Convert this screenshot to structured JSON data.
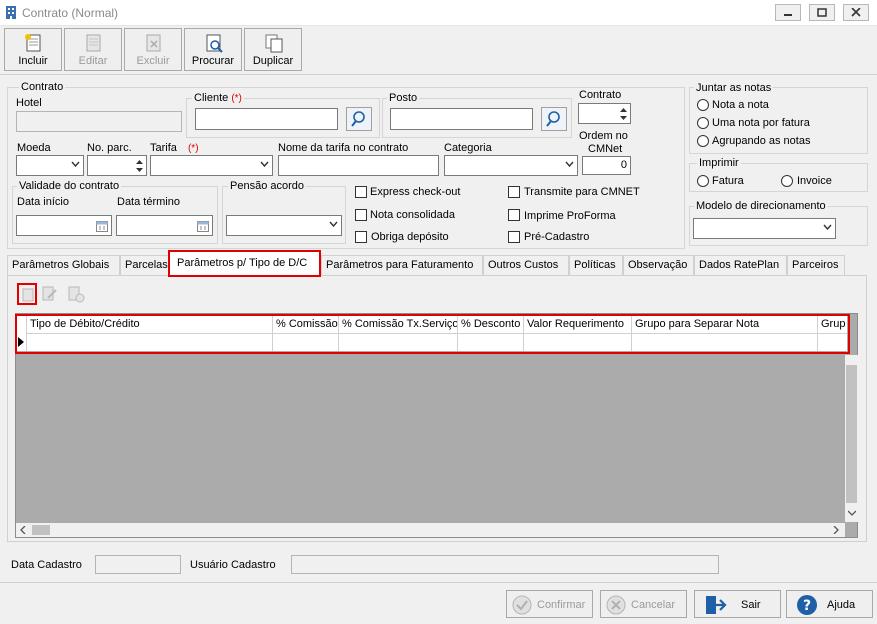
{
  "window": {
    "title": "Contrato (Normal)"
  },
  "toolbar": {
    "incluir": "Incluir",
    "editar": "Editar",
    "excluir": "Excluir",
    "procurar": "Procurar",
    "duplicar": "Duplicar"
  },
  "form": {
    "contrato_group": "Contrato",
    "hotel_label": "Hotel",
    "hotel_value": "",
    "cliente_label": "Cliente",
    "cliente_req": "(*)",
    "cliente_value": "",
    "posto_label": "Posto",
    "posto_value": "",
    "contrato_label": "Contrato",
    "contrato_value": "",
    "moeda_label": "Moeda",
    "noparc_label": "No. parc.",
    "tarifa_label": "Tarifa",
    "tarifa_req": "(*)",
    "nome_tarifa_label": "Nome da tarifa no contrato",
    "categoria_label": "Categoria",
    "ordem_label_1": "Ordem no",
    "ordem_label_2": "CMNet",
    "ordem_value": "0",
    "validade_group": "Validade do contrato",
    "data_inicio_label": "Data início",
    "data_termino_label": "Data término",
    "pensao_group": "Pensão acordo",
    "express_checkout": "Express check-out",
    "nota_consolidada": "Nota consolidada",
    "obriga_deposito": "Obriga depósito",
    "transmite_cmnet": "Transmite para CMNET",
    "imprime_proforma": "Imprime ProForma",
    "pre_cadastro": "Pré-Cadastro"
  },
  "juntar": {
    "title": "Juntar as notas",
    "opt1": "Nota a nota",
    "opt2": "Uma nota por fatura",
    "opt3": "Agrupando as notas"
  },
  "imprimir": {
    "title": "Imprimir",
    "fatura": "Fatura",
    "invoice": "Invoice"
  },
  "modelo": {
    "title": "Modelo de direcionamento",
    "value": ""
  },
  "tabs": [
    {
      "label": "Parâmetros Globais"
    },
    {
      "label": "Parcelas"
    },
    {
      "label": "Parâmetros p/ Tipo de D/C"
    },
    {
      "label": "Parâmetros para Faturamento"
    },
    {
      "label": "Outros Custos"
    },
    {
      "label": "Políticas"
    },
    {
      "label": "Observação"
    },
    {
      "label": "Dados RatePlan"
    },
    {
      "label": "Parceiros"
    }
  ],
  "grid": {
    "columns": [
      "Tipo de Débito/Crédito",
      "% Comissão",
      "% Comissão Tx.Serviço",
      "% Desconto",
      "Valor Requerimento",
      "Grupo para Separar Nota",
      "Grup"
    ]
  },
  "footer": {
    "data_cadastro_label": "Data Cadastro",
    "data_cadastro_value": "",
    "usuario_cadastro_label": "Usuário Cadastro",
    "usuario_cadastro_value": ""
  },
  "buttons": {
    "confirmar": "Confirmar",
    "cancelar": "Cancelar",
    "sair": "Sair",
    "ajuda": "Ajuda"
  }
}
